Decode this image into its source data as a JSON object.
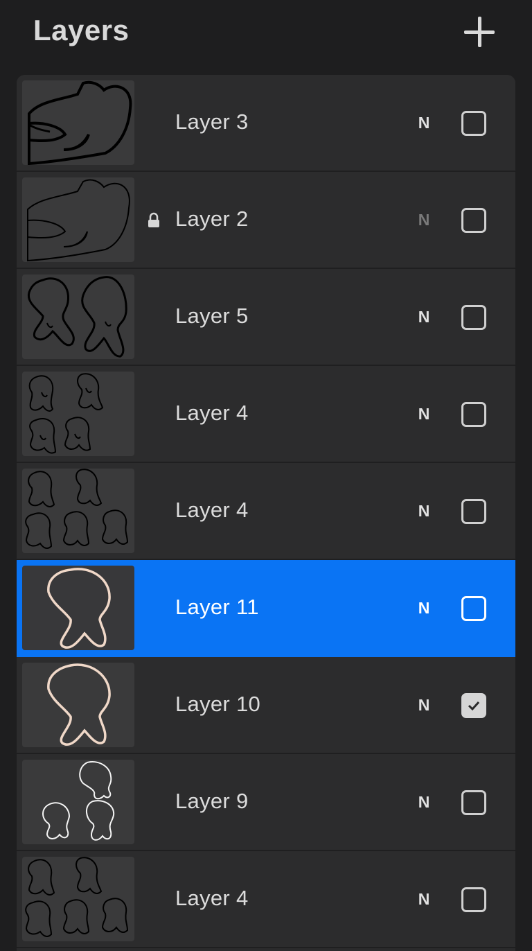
{
  "header": {
    "title": "Layers",
    "add_icon": "plus-icon"
  },
  "layers": [
    {
      "name": "Layer 3",
      "blend": "N",
      "locked": false,
      "visible": false,
      "selected": false
    },
    {
      "name": "Layer 2",
      "blend": "N",
      "locked": true,
      "visible": false,
      "selected": false
    },
    {
      "name": "Layer 5",
      "blend": "N",
      "locked": false,
      "visible": false,
      "selected": false
    },
    {
      "name": "Layer 4",
      "blend": "N",
      "locked": false,
      "visible": false,
      "selected": false
    },
    {
      "name": "Layer 4",
      "blend": "N",
      "locked": false,
      "visible": false,
      "selected": false
    },
    {
      "name": "Layer 11",
      "blend": "N",
      "locked": false,
      "visible": false,
      "selected": true
    },
    {
      "name": "Layer 10",
      "blend": "N",
      "locked": false,
      "visible": true,
      "selected": false
    },
    {
      "name": "Layer 9",
      "blend": "N",
      "locked": false,
      "visible": false,
      "selected": false
    },
    {
      "name": "Layer 4",
      "blend": "N",
      "locked": false,
      "visible": false,
      "selected": false
    }
  ],
  "colors": {
    "selected": "#0a74f4",
    "row": "#2c2c2d",
    "background": "#1e1e1f"
  }
}
